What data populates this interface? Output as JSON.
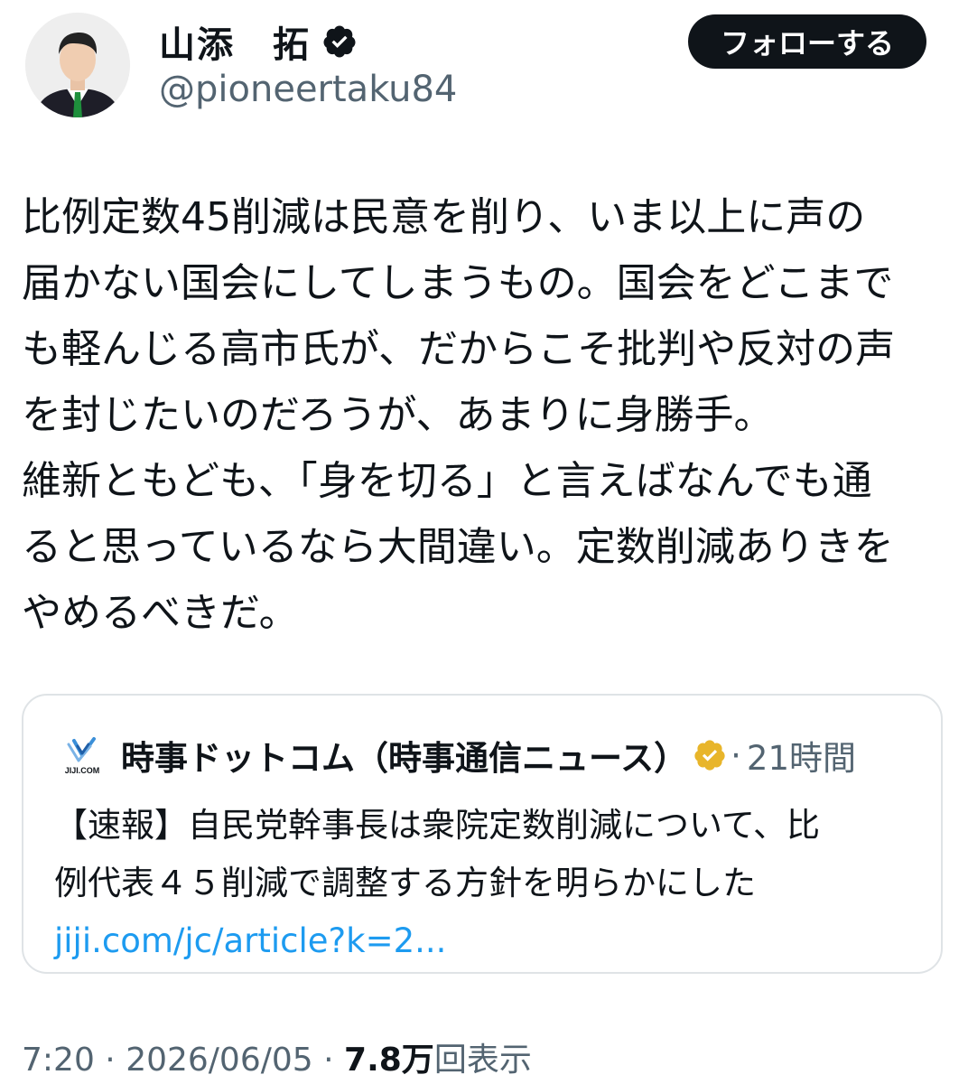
{
  "header": {
    "display_name": "山添　拓",
    "handle": "@pioneertaku84",
    "follow_label": "フォローする",
    "avatar_icon": "profile-photo",
    "verified_icon": "verified-badge-icon",
    "verified_color": "#0f1419"
  },
  "tweet": {
    "lines": [
      "比例定数45削減は民意を削り、いま以上に声の",
      "届かない国会にしてしまうもの。国会をどこまで",
      "も軽んじる高市氏が、だからこそ批判や反対の声",
      "を封じたいのだろうが、あまりに身勝手。",
      "維新ともども、「身を切る」と言えばなんでも通",
      "ると思っているなら大間違い。定数削減ありきを",
      "やめるべきだ。"
    ]
  },
  "quote": {
    "logo_text": "JIJI.COM",
    "name": "時事ドットコム（時事通信ニュース）",
    "badge_icon": "gold-verified-badge-icon",
    "badge_color": "#e8b52a",
    "separator": "·",
    "time": "21時間",
    "lines": [
      "【速報】自民党幹事長は衆院定数削減について、比",
      "例代表４５削減で調整する方針を明らかにした"
    ],
    "link": "jiji.com/jc/article?k=2..."
  },
  "meta": {
    "time": "7:20",
    "sep1": " · ",
    "date": "2026/06/05",
    "sep2": " · ",
    "views_count": "7.8万",
    "views_label": "回表示"
  },
  "colors": {
    "text": "#0f1419",
    "secondary": "#536471",
    "link": "#1d9bf0",
    "border": "#dfe3e6"
  }
}
